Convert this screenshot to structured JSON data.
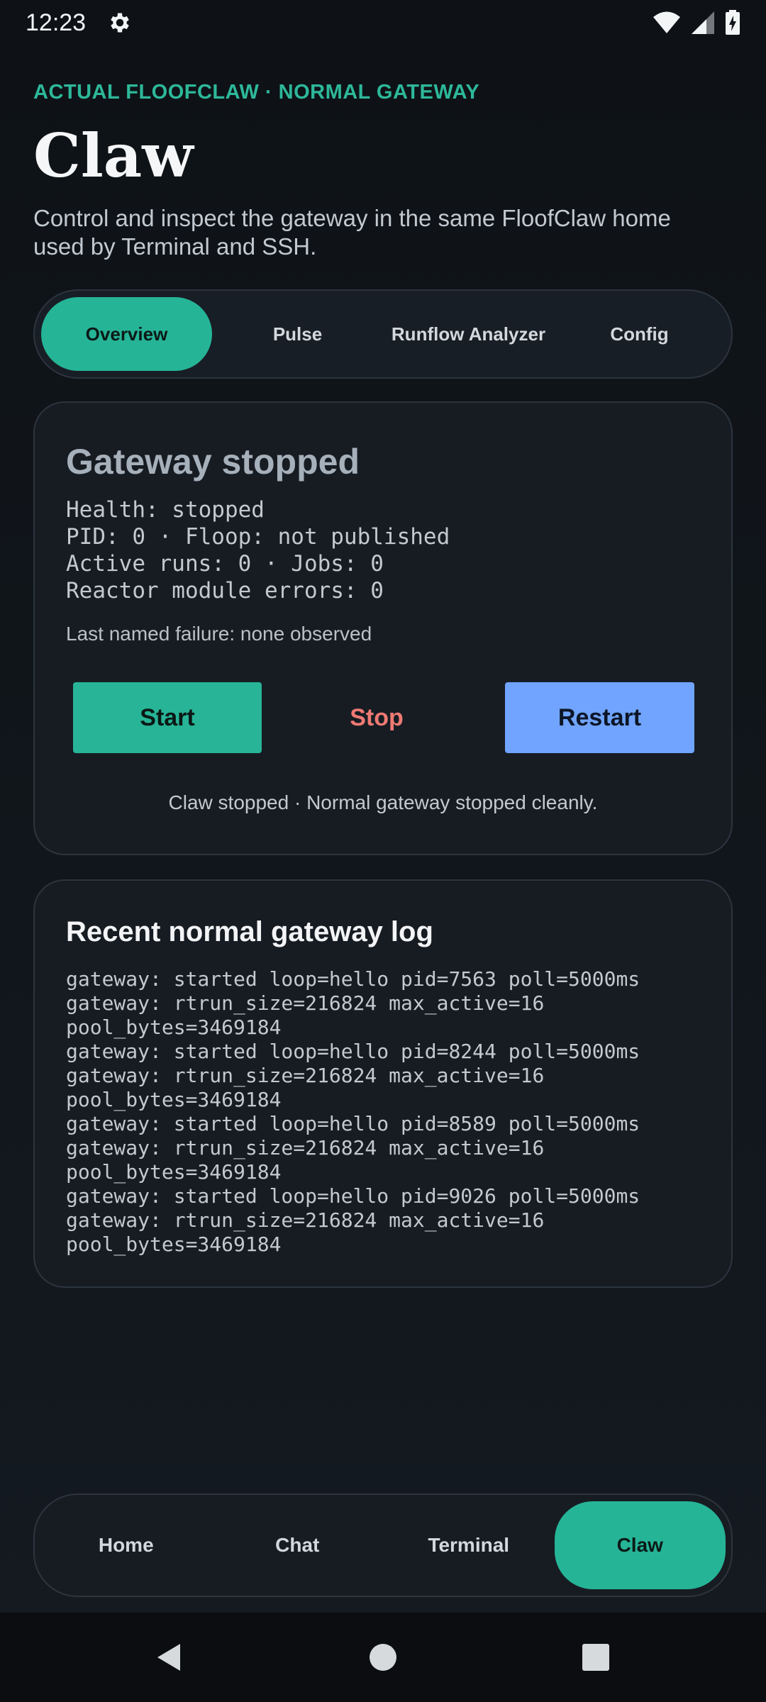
{
  "status_bar": {
    "time": "12:23",
    "icons": [
      "gear-icon",
      "wifi-icon",
      "signal-icon",
      "battery-charging-icon"
    ]
  },
  "header": {
    "eyebrow": "ACTUAL FLOOFCLAW · NORMAL GATEWAY",
    "title": "Claw",
    "description": "Control and inspect the gateway in the same FloofClaw home used by Terminal and SSH."
  },
  "tabs": [
    {
      "label": "Overview",
      "active": true
    },
    {
      "label": "Pulse",
      "active": false
    },
    {
      "label": "Runflow Analyzer",
      "active": false
    },
    {
      "label": "Config",
      "active": false
    }
  ],
  "gateway": {
    "title": "Gateway stopped",
    "stats": [
      "Health: stopped",
      "PID: 0 · Floop: not published",
      "Active runs: 0 · Jobs: 0",
      "Reactor module errors: 0"
    ],
    "last_failure": "Last named failure: none observed",
    "buttons": {
      "start": "Start",
      "stop": "Stop",
      "restart": "Restart"
    },
    "message": "Claw stopped · Normal gateway stopped cleanly."
  },
  "log": {
    "title": "Recent normal gateway log",
    "lines": [
      "gateway: started loop=hello pid=7563 poll=5000ms",
      "gateway: rtrun_size=216824 max_active=16 pool_bytes=3469184",
      "gateway: started loop=hello pid=8244 poll=5000ms",
      "gateway: rtrun_size=216824 max_active=16 pool_bytes=3469184",
      "gateway: started loop=hello pid=8589 poll=5000ms",
      "gateway: rtrun_size=216824 max_active=16 pool_bytes=3469184",
      "gateway: started loop=hello pid=9026 poll=5000ms",
      "gateway: rtrun_size=216824 max_active=16 pool_bytes=3469184"
    ]
  },
  "bottom_nav": [
    {
      "label": "Home",
      "active": false
    },
    {
      "label": "Chat",
      "active": false
    },
    {
      "label": "Terminal",
      "active": false
    },
    {
      "label": "Claw",
      "active": true
    }
  ],
  "system_nav": [
    "back-icon",
    "home-icon",
    "recents-icon"
  ],
  "colors": {
    "accent": "#26b497",
    "stop": "#f07a74",
    "restart": "#70a4ff",
    "background": "#12161c"
  }
}
